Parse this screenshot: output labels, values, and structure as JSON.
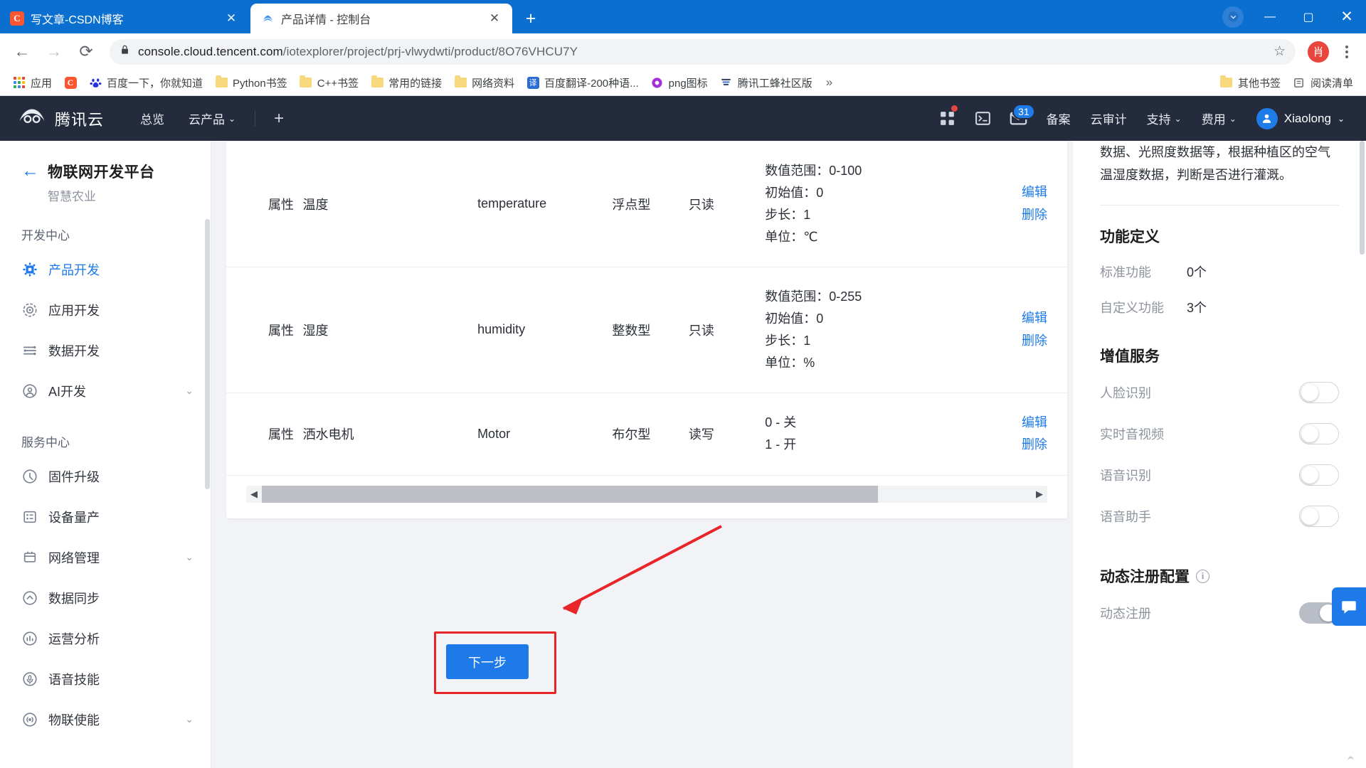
{
  "browser": {
    "tabs": [
      {
        "title": "写文章-CSDN博客",
        "favicon": "csdn-icon",
        "active": false,
        "close_label": "✕"
      },
      {
        "title": "产品详情 - 控制台",
        "favicon": "tencent-cloud-icon",
        "active": true,
        "close_label": "✕"
      }
    ],
    "new_tab_label": "+",
    "window_controls": {
      "minimize": "—",
      "maximize": "▢",
      "close": "✕"
    },
    "toolbar": {
      "back": "←",
      "forward": "→",
      "reload": "⟳",
      "lock_icon": "lock-icon",
      "url_bold": "console.cloud.tencent.com",
      "url_path": "/iotexplorer/project/prj-vlwydwti/product/8O76VHCU7Y",
      "star": "☆",
      "profile_initial": "肖"
    },
    "bookmarks": [
      {
        "label": "应用",
        "icon": "apps-grid-icon"
      },
      {
        "label": "",
        "icon": "csdn-icon"
      },
      {
        "label": "百度一下，你就知道",
        "icon": "baidu-icon"
      },
      {
        "label": "Python书签",
        "icon": "folder-icon"
      },
      {
        "label": "C++书签",
        "icon": "folder-icon"
      },
      {
        "label": "常用的链接",
        "icon": "folder-icon"
      },
      {
        "label": "网络资料",
        "icon": "folder-icon"
      },
      {
        "label": "百度翻译-200种语...",
        "icon": "fanyi-icon"
      },
      {
        "label": "png图标",
        "icon": "png-icon"
      },
      {
        "label": "腾讯工蜂社区版",
        "icon": "gongfeng-icon"
      }
    ],
    "bookmarks_overflow": "»",
    "bookmarks_right": [
      {
        "label": "其他书签",
        "icon": "folder-icon"
      },
      {
        "label": "阅读清单",
        "icon": "reading-list-icon"
      }
    ]
  },
  "tc_header": {
    "logo_text": "腾讯云",
    "nav": [
      {
        "label": "总览",
        "has_caret": false
      },
      {
        "label": "云产品",
        "has_caret": true
      }
    ],
    "plus_label": "+",
    "icons": [
      {
        "name": "grid-apps-icon",
        "has_reddot": true
      },
      {
        "name": "console-terminal-icon",
        "has_reddot": false
      },
      {
        "name": "mail-icon",
        "badge": "31"
      }
    ],
    "right_items": [
      {
        "label": "备案",
        "has_caret": false
      },
      {
        "label": "云审计",
        "has_caret": false
      },
      {
        "label": "支持",
        "has_caret": true
      },
      {
        "label": "费用",
        "has_caret": true
      }
    ],
    "user": {
      "name": "Xiaolong",
      "avatar_icon": "user-avatar-icon",
      "caret": "⌄"
    }
  },
  "sidebar": {
    "back_icon": "arrow-left-icon",
    "title": "物联网开发平台",
    "subtitle": "智慧农业",
    "groups": [
      {
        "label": "开发中心",
        "items": [
          {
            "label": "产品开发",
            "icon": "chip-icon",
            "active": true,
            "caret": ""
          },
          {
            "label": "应用开发",
            "icon": "target-icon",
            "active": false,
            "caret": ""
          },
          {
            "label": "数据开发",
            "icon": "sliders-icon",
            "active": false,
            "caret": ""
          },
          {
            "label": "AI开发",
            "icon": "ai-circle-icon",
            "active": false,
            "caret": "⌄"
          }
        ]
      },
      {
        "label": "服务中心",
        "items": [
          {
            "label": "固件升级",
            "icon": "firmware-icon",
            "active": false,
            "caret": ""
          },
          {
            "label": "设备量产",
            "icon": "device-list-icon",
            "active": false,
            "caret": ""
          },
          {
            "label": "网络管理",
            "icon": "network-icon",
            "active": false,
            "caret": "⌄"
          },
          {
            "label": "数据同步",
            "icon": "sync-icon",
            "active": false,
            "caret": ""
          },
          {
            "label": "运营分析",
            "icon": "analytics-icon",
            "active": false,
            "caret": ""
          },
          {
            "label": "语音技能",
            "icon": "voice-icon",
            "active": false,
            "caret": ""
          },
          {
            "label": "物联使能",
            "icon": "iot-enable-icon",
            "active": false,
            "caret": "⌄"
          }
        ]
      }
    ]
  },
  "table": {
    "rows": [
      {
        "type": "属性",
        "name": "温度",
        "identifier": "temperature",
        "datatype": "浮点型",
        "rw": "只读",
        "detail": [
          "数值范围：0-100",
          "初始值：0",
          "步长：1",
          "单位：℃"
        ],
        "actions": [
          "编辑",
          "删除"
        ]
      },
      {
        "type": "属性",
        "name": "湿度",
        "identifier": "humidity",
        "datatype": "整数型",
        "rw": "只读",
        "detail": [
          "数值范围：0-255",
          "初始值：0",
          "步长：1",
          "单位：%"
        ],
        "actions": [
          "编辑",
          "删除"
        ]
      },
      {
        "type": "属性",
        "name": "洒水电机",
        "identifier": "Motor",
        "datatype": "布尔型",
        "rw": "读写",
        "detail": [
          "0 - 关",
          "1 - 开"
        ],
        "actions": [
          "编辑",
          "删除"
        ]
      }
    ],
    "hscroll": {
      "left_arrow": "◀",
      "right_arrow": "▶"
    }
  },
  "actions": {
    "next_label": "下一步"
  },
  "right_panel": {
    "description": "数据、光照度数据等，根据种植区的空气温湿度数据，判断是否进行灌溉。",
    "function_def": {
      "heading": "功能定义",
      "rows": [
        {
          "label": "标准功能",
          "value": "0个"
        },
        {
          "label": "自定义功能",
          "value": "3个"
        }
      ]
    },
    "value_added": {
      "heading": "增值服务",
      "rows": [
        {
          "label": "人脸识别",
          "on": false
        },
        {
          "label": "实时音视频",
          "on": false
        },
        {
          "label": "语音识别",
          "on": false
        },
        {
          "label": "语音助手",
          "on": false
        }
      ]
    },
    "dynamic_reg": {
      "heading": "动态注册配置",
      "info_icon": "info-icon",
      "rows": [
        {
          "label": "动态注册",
          "on": true
        }
      ]
    }
  },
  "floating": {
    "chat_icon": "chat-bubble-icon"
  },
  "colors": {
    "accent_blue": "#1d7ae8",
    "header_dark": "#232b3c",
    "chrome_blue": "#0b6fd0",
    "annotation_red": "#e8262a"
  }
}
